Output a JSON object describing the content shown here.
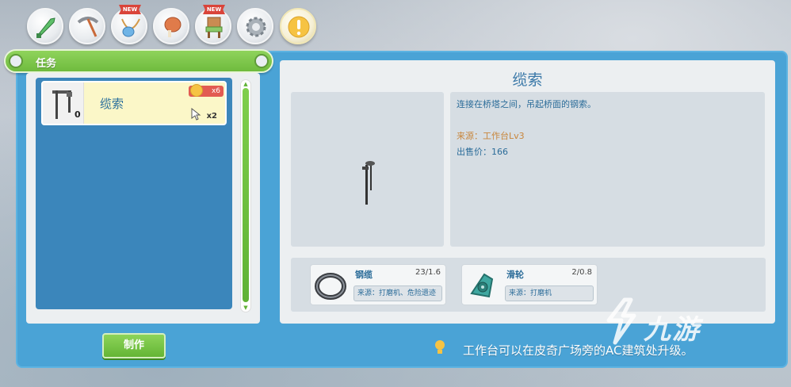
{
  "tabs": [
    {
      "icon": "sword-icon",
      "new": false,
      "active": false
    },
    {
      "icon": "pickaxe-icon",
      "new": false,
      "active": false
    },
    {
      "icon": "necklace-icon",
      "new": true,
      "active": false
    },
    {
      "icon": "meat-icon",
      "new": false,
      "active": false
    },
    {
      "icon": "chair-icon",
      "new": true,
      "active": false
    },
    {
      "icon": "gear-icon",
      "new": false,
      "active": false
    },
    {
      "icon": "exclamation-icon",
      "new": false,
      "active": true
    }
  ],
  "new_label": "NEW",
  "panel_title": "任务",
  "list": {
    "items": [
      {
        "name": "缆索",
        "owned": "0",
        "required_count": "x6",
        "cursor_count": "x2"
      }
    ]
  },
  "craft_button": "制作",
  "detail": {
    "title": "缆索",
    "description": "连接在桥塔之间，吊起桥面的钢索。",
    "source": "来源：工作台Lv3",
    "price": "出售价：166"
  },
  "materials": [
    {
      "name": "钢缆",
      "qty": "23/1.6",
      "source": "来源：打磨机、危险遗迹",
      "icon": "steel-cable-icon"
    },
    {
      "name": "滑轮",
      "qty": "2/0.8",
      "source": "来源：打磨机",
      "icon": "pulley-icon"
    }
  ],
  "tip": "工作台可以在皮奇广场旁的AC建筑处升级。",
  "watermark": "九游",
  "colors": {
    "frame": "#4aa3d6",
    "accent_green": "#6fbb3e",
    "title_blue": "#3a78a8",
    "source_orange": "#c8863c"
  }
}
